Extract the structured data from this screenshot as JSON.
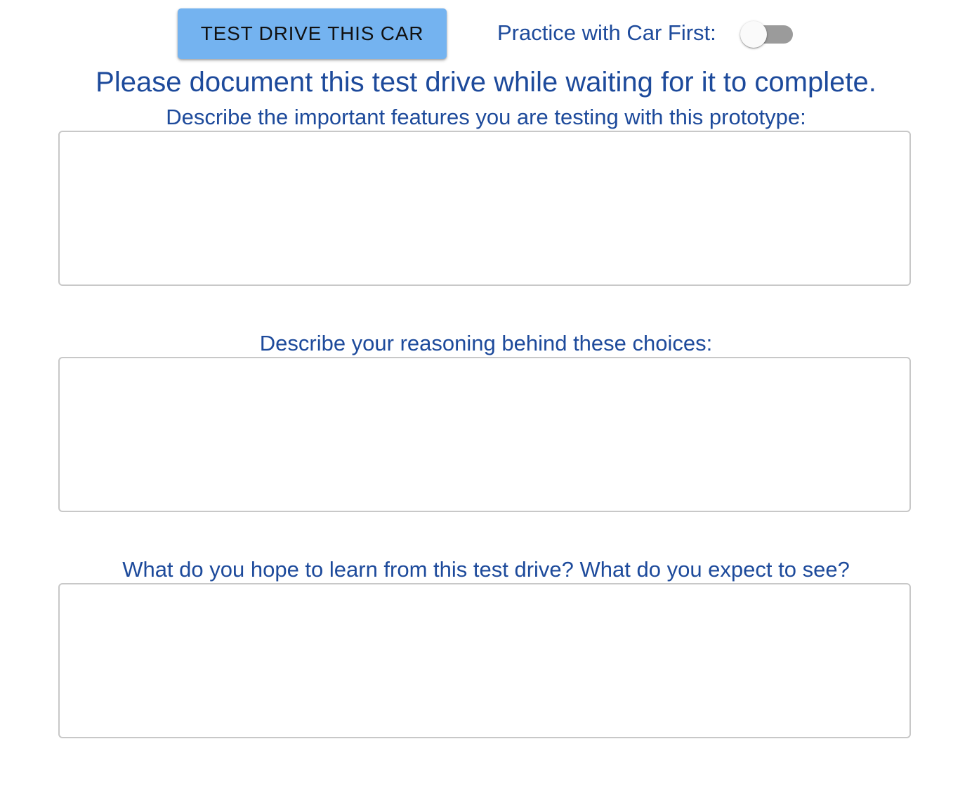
{
  "toolbar": {
    "test_drive_label": "TEST DRIVE THIS CAR",
    "practice_label": "Practice with Car First:",
    "practice_toggle_on": false
  },
  "heading": "Please document this test drive while waiting for it to complete.",
  "fields": [
    {
      "label": "Describe the important features you are testing with this prototype:",
      "value": ""
    },
    {
      "label": "Describe your reasoning behind these choices:",
      "value": ""
    },
    {
      "label": "What do you hope to learn from this test drive? What do you expect to see?",
      "value": ""
    }
  ],
  "colors": {
    "text": "#1d4a9b",
    "button_bg": "#74b3f0",
    "toggle_track": "#9b9b9b",
    "field_border": "#c8c8c8"
  }
}
